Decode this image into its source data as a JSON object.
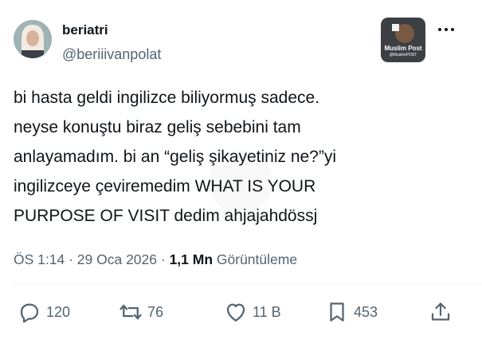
{
  "author": {
    "name": "beriatri",
    "handle": "@beriiivanpolat"
  },
  "tweet": {
    "lines": [
      "bi hasta geldi ingilizce biliyormuş sadece.",
      "neyse konuştu biraz geliş sebebini tam",
      "anlayamadım. bi an “geliş şikayetiniz ne?”yi",
      "ingilizceye çeviremedim WHAT IS YOUR",
      "PURPOSE OF VISIT dedim ahjajahdössj"
    ]
  },
  "meta": {
    "time": "ÖS 1:14",
    "sep1": " · ",
    "date": "29 Oca 2026",
    "sep2": " · ",
    "views": "1,1 Mn",
    "views_label": " Görüntüleme"
  },
  "badge": {
    "title": "Muslim Post",
    "handle": "@MuslimPOST"
  },
  "actions": {
    "reply_count": "120",
    "retweet_count": "76",
    "like_count": "11 B",
    "bookmark_count": "453"
  },
  "colors": {
    "text": "#0f1419",
    "muted": "#536471"
  }
}
